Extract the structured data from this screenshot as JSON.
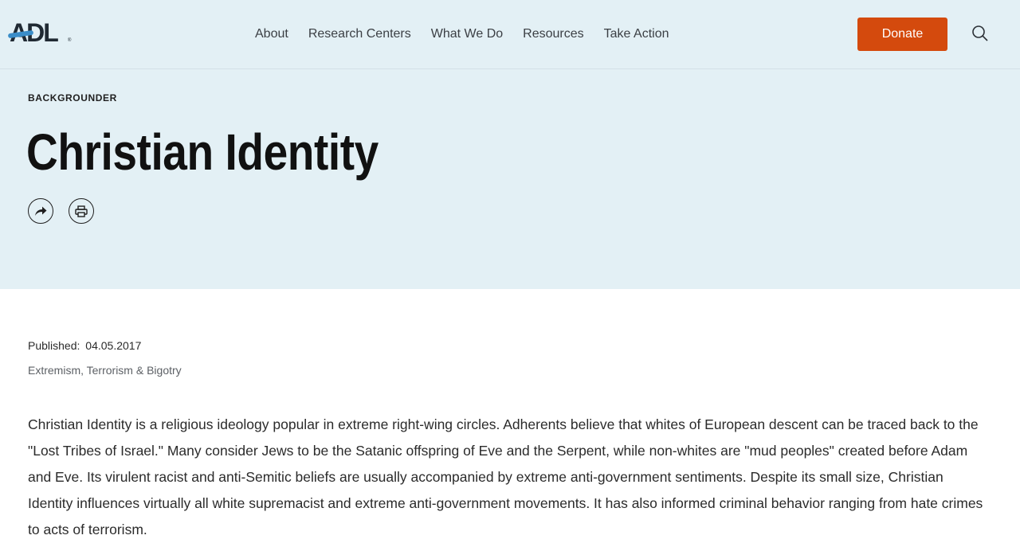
{
  "header": {
    "logo_text": "ADL",
    "logo_reg": "®",
    "nav": [
      {
        "label": "About"
      },
      {
        "label": "Research Centers"
      },
      {
        "label": "What We Do"
      },
      {
        "label": "Resources"
      },
      {
        "label": "Take Action"
      }
    ],
    "donate_label": "Donate",
    "search_icon": "search-icon"
  },
  "hero": {
    "eyebrow": "BACKGROUNDER",
    "title": "Christian Identity",
    "share_icon": "share-icon",
    "print_icon": "print-icon"
  },
  "article": {
    "published_label": "Published:",
    "published_date": "04.05.2017",
    "topic": "Extremism, Terrorism & Bigotry",
    "body": "Christian Identity is a religious ideology popular in extreme right-wing circles. Adherents believe that whites of European descent can be traced back to the \"Lost Tribes of Israel.\" Many consider Jews to be the Satanic offspring of Eve and the Serpent, while non-whites are \"mud peoples\" created before Adam and Eve. Its virulent racist and anti-Semitic beliefs are usually accompanied by extreme anti-government sentiments. Despite its small size, Christian Identity influences virtually all white supremacist and extreme anti-government movements. It has also informed criminal behavior ranging from hate crimes to acts of terrorism."
  },
  "colors": {
    "header_bg": "#e3f0f5",
    "donate_bg": "#d44a0d",
    "logo_accent": "#3a8dc8"
  }
}
